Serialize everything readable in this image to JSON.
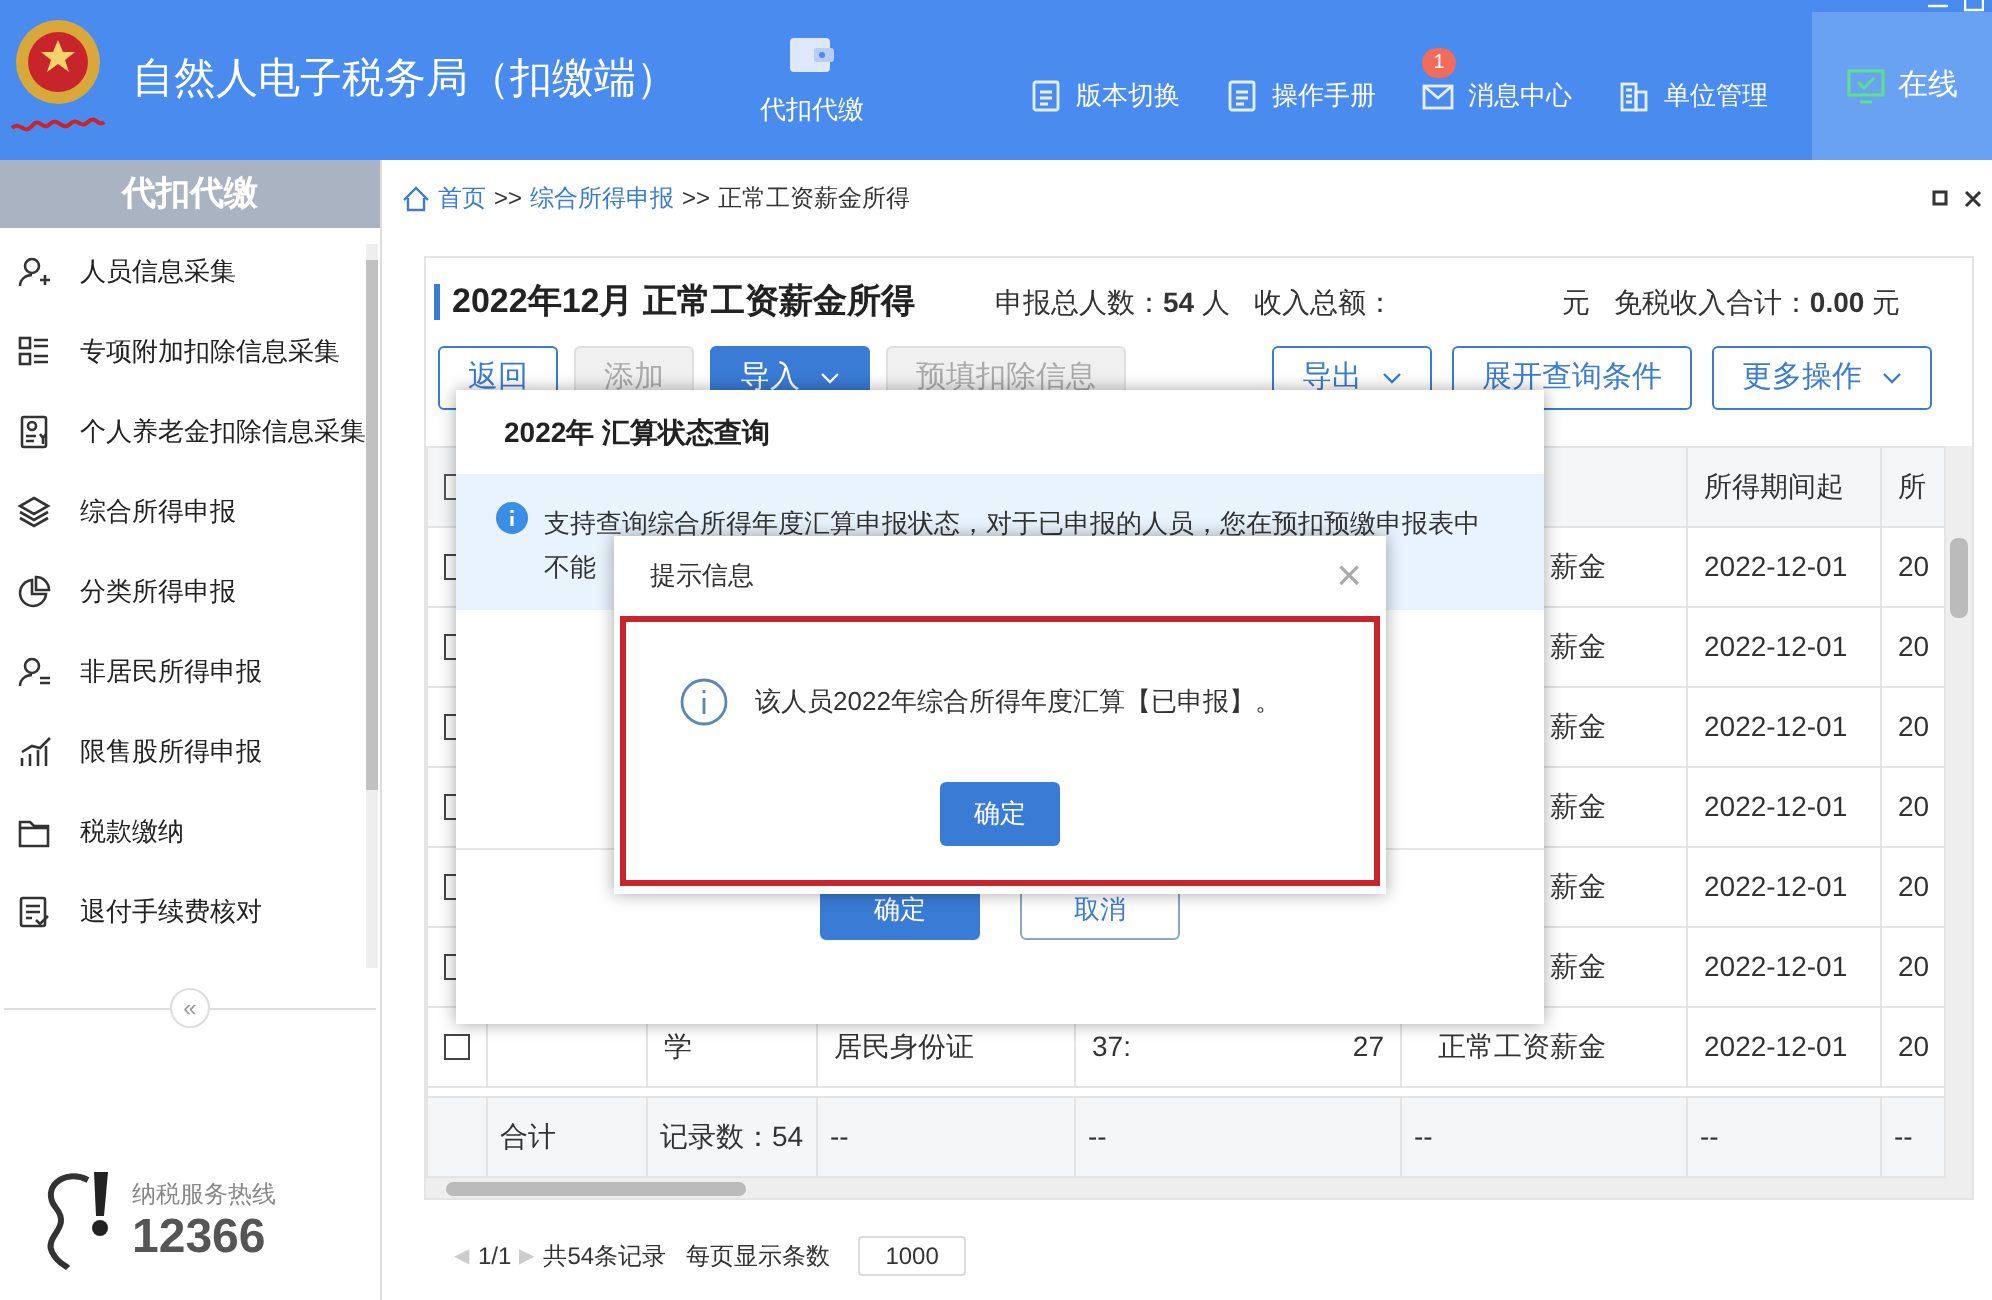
{
  "header": {
    "title": "自然人电子税务局（扣缴端）",
    "module": {
      "label": "代扣代缴",
      "selected": true
    },
    "actions": [
      {
        "kind": "doc",
        "label": "版本切换"
      },
      {
        "kind": "doc",
        "label": "操作手册"
      },
      {
        "kind": "mail",
        "label": "消息中心",
        "badge": "1"
      },
      {
        "kind": "building",
        "label": "单位管理"
      }
    ],
    "status": {
      "label": "在线",
      "on": true
    }
  },
  "sidebar": {
    "title": "代扣代缴",
    "items": [
      {
        "label": "人员信息采集"
      },
      {
        "label": "专项附加扣除信息采集"
      },
      {
        "label": "个人养老金扣除信息采集"
      },
      {
        "label": "综合所得申报"
      },
      {
        "label": "分类所得申报"
      },
      {
        "label": "非居民所得申报"
      },
      {
        "label": "限售股所得申报"
      },
      {
        "label": "税款缴纳"
      },
      {
        "label": "退付手续费核对"
      }
    ],
    "collapse": "«",
    "hotline_label": "纳税服务热线",
    "hotline_number": "12366"
  },
  "breadcrumb": [
    {
      "label": "首页",
      "link": true
    },
    {
      "label": ">>",
      "link": false
    },
    {
      "label": "综合所得申报",
      "link": true
    },
    {
      "label": ">>",
      "link": false
    },
    {
      "label": "正常工资薪金所得",
      "link": false
    }
  ],
  "summary": {
    "title": "2022年12月 正常工资薪金所得",
    "total_people": "申报总人数：**54** 人",
    "income_label": "收入总额：",
    "income_unit": "元",
    "tax_free": "免税收入合计：**0.00** 元"
  },
  "toolbar": [
    {
      "label": "返回",
      "kind": "outline",
      "disabled": false,
      "dropdown": false
    },
    {
      "label": "添加",
      "kind": "plain",
      "disabled": true,
      "dropdown": false
    },
    {
      "label": "导入",
      "kind": "primary",
      "disabled": false,
      "dropdown": true
    },
    {
      "label": "预填扣除信息",
      "kind": "plain",
      "disabled": true,
      "dropdown": false
    },
    {
      "label": "导出",
      "kind": "outline",
      "disabled": false,
      "dropdown": true
    },
    {
      "label": "展开查询条件",
      "kind": "outline",
      "disabled": false,
      "dropdown": false
    },
    {
      "label": "更多操作",
      "kind": "outline",
      "disabled": false,
      "dropdown": true
    }
  ],
  "table": {
    "select_all_checked": false,
    "columns": [
      "",
      "",
      "",
      "",
      "",
      "所得期间起",
      "所"
    ],
    "rows": [
      {
        "checked": false,
        "cells": [
          null,
          null,
          null,
          null,
          "薪金",
          "2022-12-01",
          "20"
        ]
      },
      {
        "checked": false,
        "cells": [
          null,
          null,
          null,
          null,
          "薪金",
          "2022-12-01",
          "20"
        ]
      },
      {
        "checked": false,
        "cells": [
          null,
          null,
          null,
          null,
          "薪金",
          "2022-12-01",
          "20"
        ]
      },
      {
        "checked": false,
        "cells": [
          null,
          null,
          null,
          null,
          "薪金",
          "2022-12-01",
          "20"
        ]
      },
      {
        "checked": false,
        "cells": [
          null,
          null,
          null,
          null,
          "薪金",
          "2022-12-01",
          "20"
        ]
      },
      {
        "checked": false,
        "cells": [
          null,
          null,
          null,
          null,
          "薪金",
          "2022-12-01",
          "20"
        ]
      },
      {
        "checked": false,
        "cells": [
          null,
          "学",
          "居民身份证",
          [
            "37:",
            "27"
          ],
          "正常工资薪金",
          "2022-12-01",
          "20"
        ]
      }
    ],
    "total_row": [
      "合计",
      "记录数：54",
      "--",
      "--",
      "--",
      "--",
      "--"
    ]
  },
  "pagination": {
    "prev": "◀",
    "page": "1/1",
    "next": "▶",
    "count": "共54条记录",
    "per_page_label": "每页显示条数",
    "per_page": "1000"
  },
  "outer_dialog": {
    "title": "2022年 汇算状态查询",
    "info_lines": [
      "支持查询综合所得年度汇算申报状态，对于已申报的人员，您在预扣预缴申报表中",
      "不能"
    ],
    "buttons": [
      {
        "label": "确定",
        "kind": "primary"
      },
      {
        "label": "取消",
        "kind": "secondary"
      }
    ]
  },
  "inner_dialog": {
    "title": "提示信息",
    "close": "×",
    "message": "该人员2022年综合所得年度汇算【已申报】。",
    "highlighted": true,
    "button": "确定"
  }
}
